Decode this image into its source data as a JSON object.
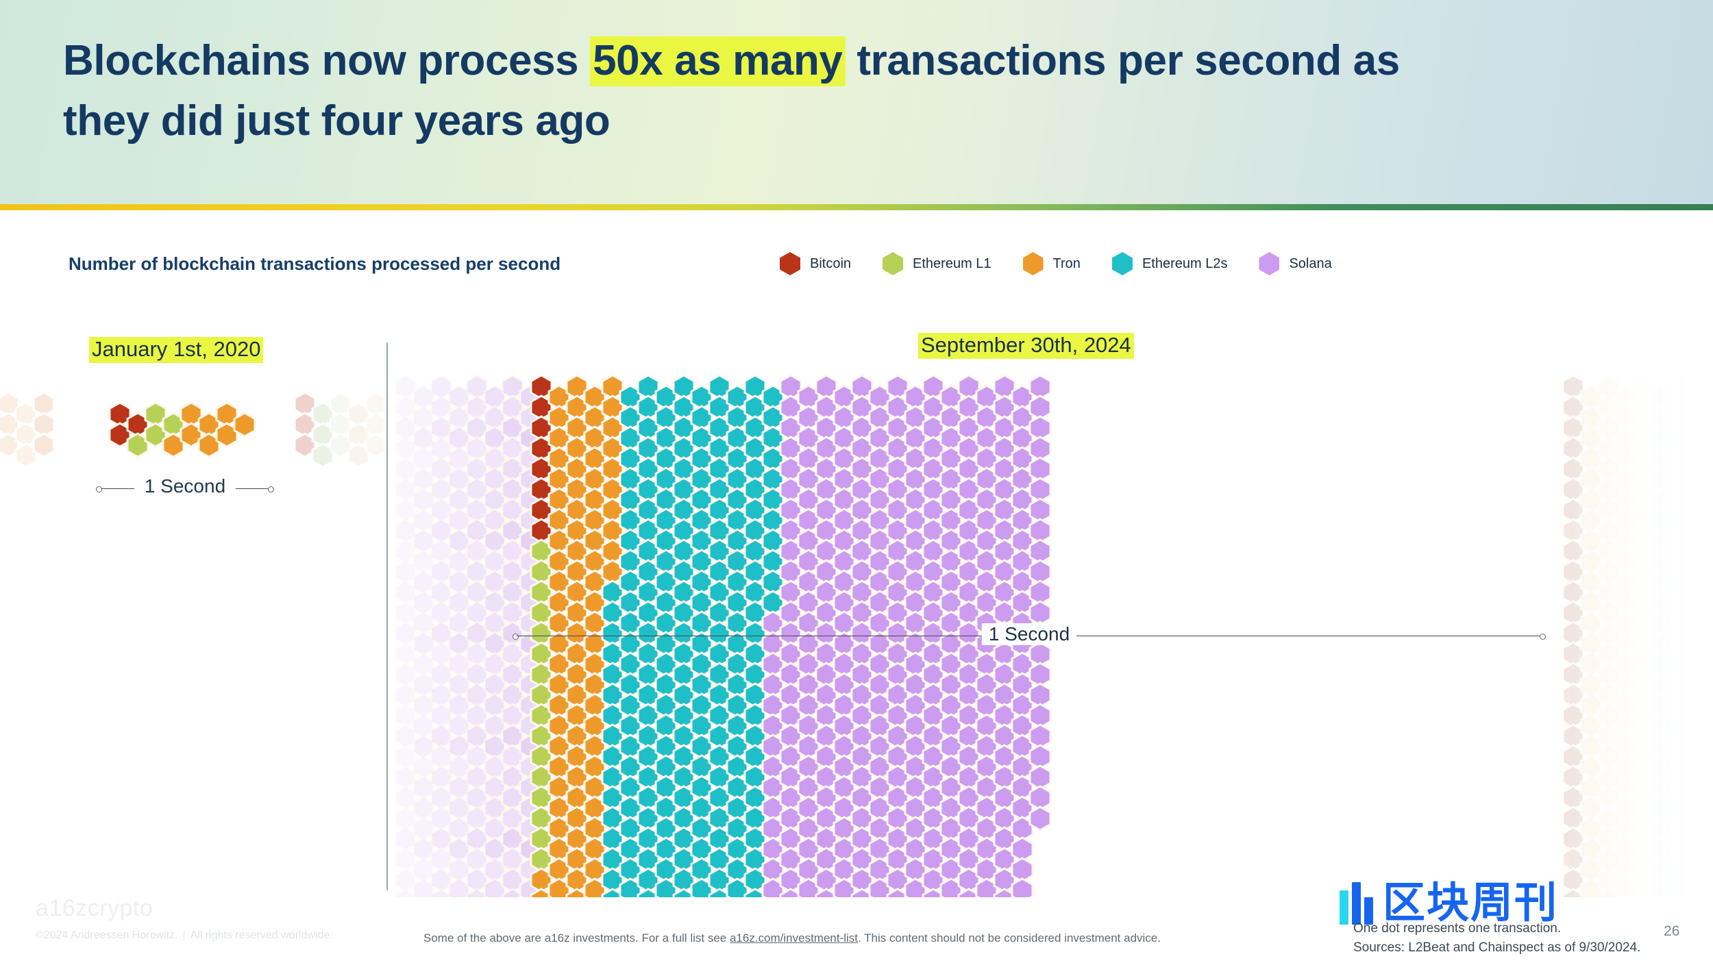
{
  "header": {
    "title_part1": "Blockchains now process ",
    "title_highlight": "50x as many",
    "title_part2": " transactions per second as",
    "title_line2": "they did just four years ago",
    "accent_navy": "#143a63",
    "highlight_yellow": "#e9f743"
  },
  "chart": {
    "subtitle": "Number of blockchain transactions processed per second",
    "left_date_label": "January 1st, 2020",
    "right_date_label": "September 30th, 2024",
    "measure_label_left": "1 Second",
    "measure_label_right": "1 Second",
    "legend": [
      {
        "label": "Bitcoin",
        "color": "#b93418"
      },
      {
        "label": "Ethereum L1",
        "color": "#b7d157"
      },
      {
        "label": "Tron",
        "color": "#ee9a2b"
      },
      {
        "label": "Ethereum L2s",
        "color": "#1fbfc8"
      },
      {
        "label": "Solana",
        "color": "#cc9cf0"
      }
    ]
  },
  "chart_data": {
    "type": "waffle",
    "title": "Number of blockchain transactions processed per second",
    "unit_note": "One dot represents one transaction.",
    "ratio_callout": "50x",
    "panels": [
      {
        "name": "January 1st, 2020",
        "date": "2020-01-01",
        "total_tps": 15,
        "series": [
          {
            "name": "Bitcoin",
            "color": "#b93418",
            "value": 3
          },
          {
            "name": "Ethereum L1",
            "color": "#b7d157",
            "value": 4
          },
          {
            "name": "Tron",
            "color": "#ee9a2b",
            "value": 8
          },
          {
            "name": "Ethereum L2s",
            "color": "#1fbfc8",
            "value": 0
          },
          {
            "name": "Solana",
            "color": "#cc9cf0",
            "value": 0
          }
        ]
      },
      {
        "name": "September 30th, 2024",
        "date": "2024-09-30",
        "total_tps": 750,
        "series": [
          {
            "name": "Bitcoin",
            "color": "#b93418",
            "value": 8
          },
          {
            "name": "Ethereum L1",
            "color": "#b7d157",
            "value": 16
          },
          {
            "name": "Tron",
            "color": "#ee9a2b",
            "value": 90
          },
          {
            "name": "Ethereum L2s",
            "color": "#1fbfc8",
            "value": 235
          },
          {
            "name": "Solana",
            "color": "#cc9cf0",
            "value": 401
          }
        ]
      }
    ],
    "grid": {
      "hex_width": 30,
      "hex_height": 34,
      "col_step": 26,
      "row_step": 30,
      "rows": 26,
      "cols": 77,
      "fade_edges": true
    }
  },
  "footer": {
    "logo": "a16zcrypto",
    "copyright": "©2024 Andreessen Horowitz.",
    "rights": "All rights reserved worldwide.",
    "disclaimer_pre": "Some of the above are a16z investments. For a full list see ",
    "disclaimer_link": "a16z.com/investment-list",
    "disclaimer_post": ". This content should not be considered investment advice.",
    "note": "One dot represents one transaction.",
    "sources": "Sources: L2Beat and Chainspect as of 9/30/2024.",
    "page_number": "26",
    "watermark_text": "区块周刊"
  }
}
